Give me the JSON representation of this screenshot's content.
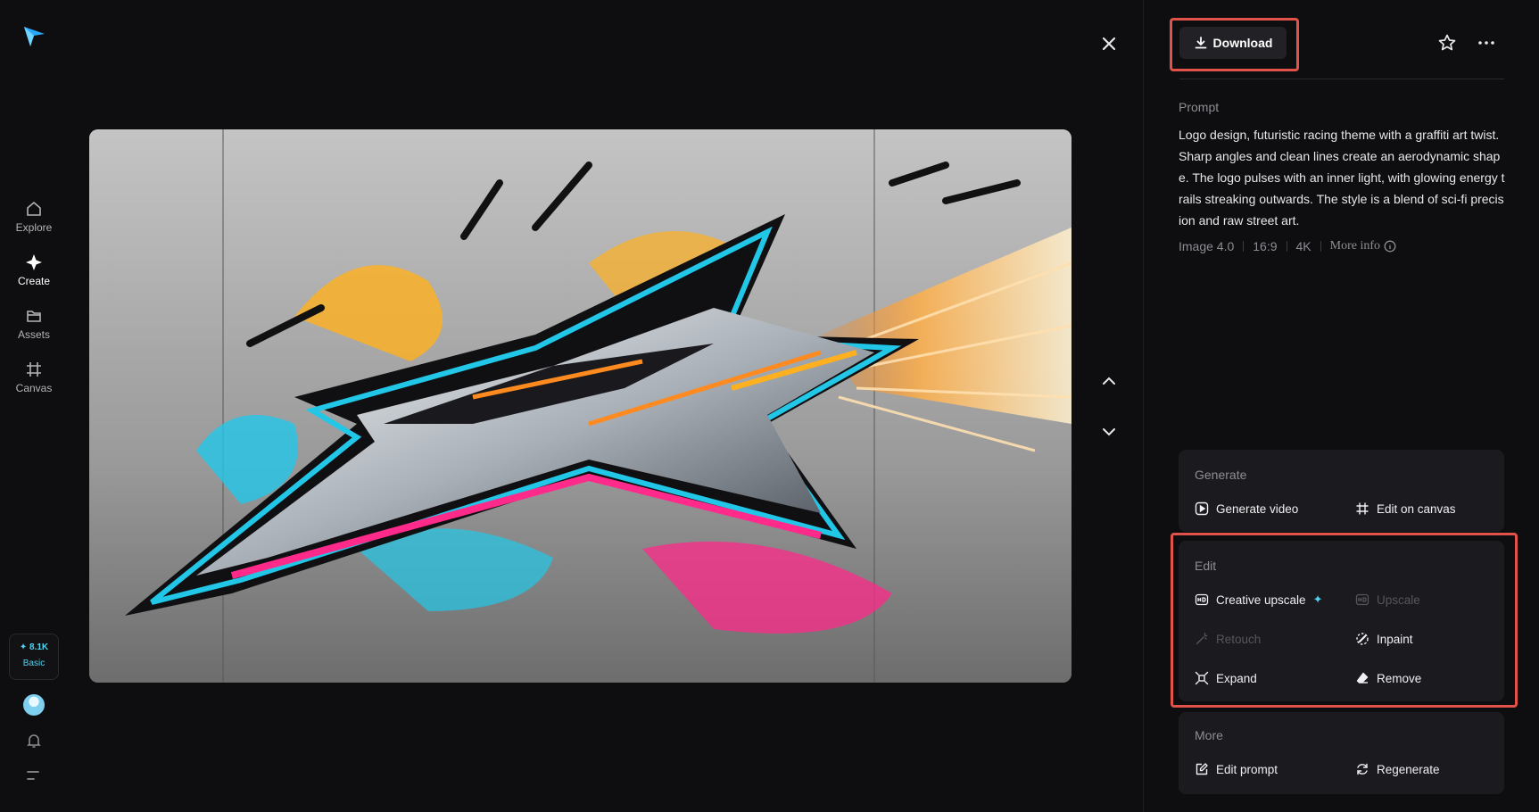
{
  "sidebar": {
    "nav": [
      {
        "label": "Explore",
        "icon": "home-icon"
      },
      {
        "label": "Create",
        "icon": "sparkle-icon"
      },
      {
        "label": "Assets",
        "icon": "folder-icon"
      },
      {
        "label": "Canvas",
        "icon": "canvas-icon"
      }
    ],
    "credits": {
      "amount": "8.1K",
      "plan": "Basic"
    }
  },
  "toolbar": {
    "download_label": "Download"
  },
  "prompt": {
    "label": "Prompt",
    "text": "Logo design, futuristic racing theme with a graffiti art twist. Sharp angles and clean lines create an aerodynamic shape. The logo pulses with an inner light, with glowing energy trails streaking outwards. The style is a blend of sci-fi precision and raw street art.",
    "meta": {
      "model": "Image 4.0",
      "ratio": "16:9",
      "resolution": "4K",
      "more_info": "More info"
    }
  },
  "generate": {
    "title": "Generate",
    "actions": [
      {
        "label": "Generate video",
        "icon": "play-square-icon"
      },
      {
        "label": "Edit on canvas",
        "icon": "canvas-icon"
      }
    ]
  },
  "edit": {
    "title": "Edit",
    "actions": [
      {
        "label": "Creative upscale",
        "icon": "hd-upscale-icon",
        "disabled": false
      },
      {
        "label": "Upscale",
        "icon": "hd-icon",
        "disabled": true
      },
      {
        "label": "Retouch",
        "icon": "magic-wand-icon",
        "disabled": true
      },
      {
        "label": "Inpaint",
        "icon": "inpaint-icon",
        "disabled": false
      },
      {
        "label": "Expand",
        "icon": "expand-icon",
        "disabled": false
      },
      {
        "label": "Remove",
        "icon": "eraser-icon",
        "disabled": false
      }
    ]
  },
  "more": {
    "title": "More",
    "actions": [
      {
        "label": "Edit prompt",
        "icon": "edit-prompt-icon"
      },
      {
        "label": "Regenerate",
        "icon": "regenerate-icon"
      }
    ]
  },
  "colors": {
    "accent": "#4fd3f0",
    "highlight": "#e0524a",
    "background": "#0e0e10",
    "card": "#1b1b1f"
  }
}
